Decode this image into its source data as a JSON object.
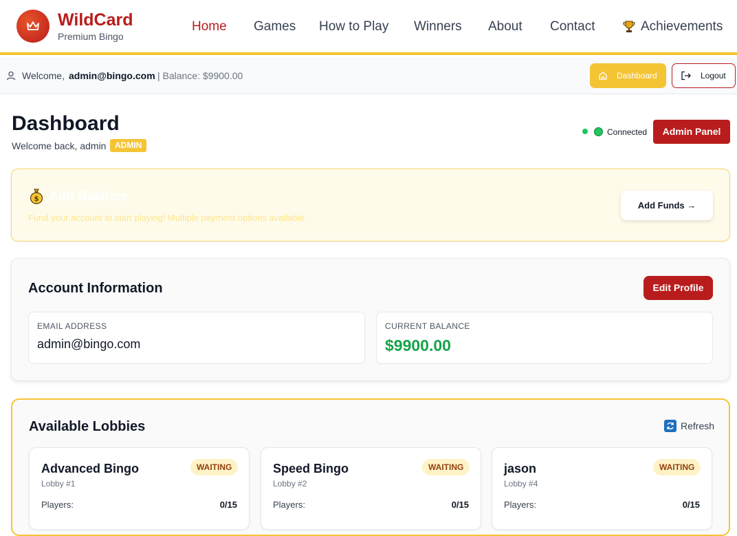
{
  "brand": {
    "name": "WildCard",
    "subtitle": "Premium Bingo"
  },
  "nav": {
    "items": [
      {
        "label": "Home",
        "active": true
      },
      {
        "label": "Games"
      },
      {
        "label": "How to Play"
      },
      {
        "label": "Winners"
      },
      {
        "label": "About"
      },
      {
        "label": "Contact"
      },
      {
        "label": "Achievements",
        "icon": "trophy-icon"
      }
    ]
  },
  "welcome_bar": {
    "welcome": "Welcome,",
    "email": "admin@bingo.com",
    "balance": "| Balance: $9900.00",
    "dashboard_button": "Dashboard",
    "logout_button": "Logout"
  },
  "dashboard": {
    "title": "Dashboard",
    "subtitle": "Welcome back, admin",
    "role_badge": "ADMIN",
    "connection_status": "Connected",
    "admin_panel_button": "Admin Panel"
  },
  "add_balance": {
    "title": "Add Balance",
    "description": "Fund your account to start playing! Multiple payment options available.",
    "button": "Add Funds →"
  },
  "account": {
    "title": "Account Information",
    "edit_button": "Edit Profile",
    "email_label": "EMAIL ADDRESS",
    "email_value": "admin@bingo.com",
    "balance_label": "CURRENT BALANCE",
    "balance_value": "$9900.00"
  },
  "lobbies": {
    "title": "Available Lobbies",
    "refresh": "Refresh",
    "players_label": "Players:",
    "items": [
      {
        "name": "Advanced Bingo",
        "id": "Lobby #1",
        "status": "WAITING",
        "players": "0/15"
      },
      {
        "name": "Speed Bingo",
        "id": "Lobby #2",
        "status": "WAITING",
        "players": "0/15"
      },
      {
        "name": "jason",
        "id": "Lobby #4",
        "status": "WAITING",
        "players": "0/15"
      }
    ]
  },
  "colors": {
    "brand_red": "#b91c1c",
    "accent_yellow": "#f5c434",
    "success_green": "#16a34a"
  }
}
